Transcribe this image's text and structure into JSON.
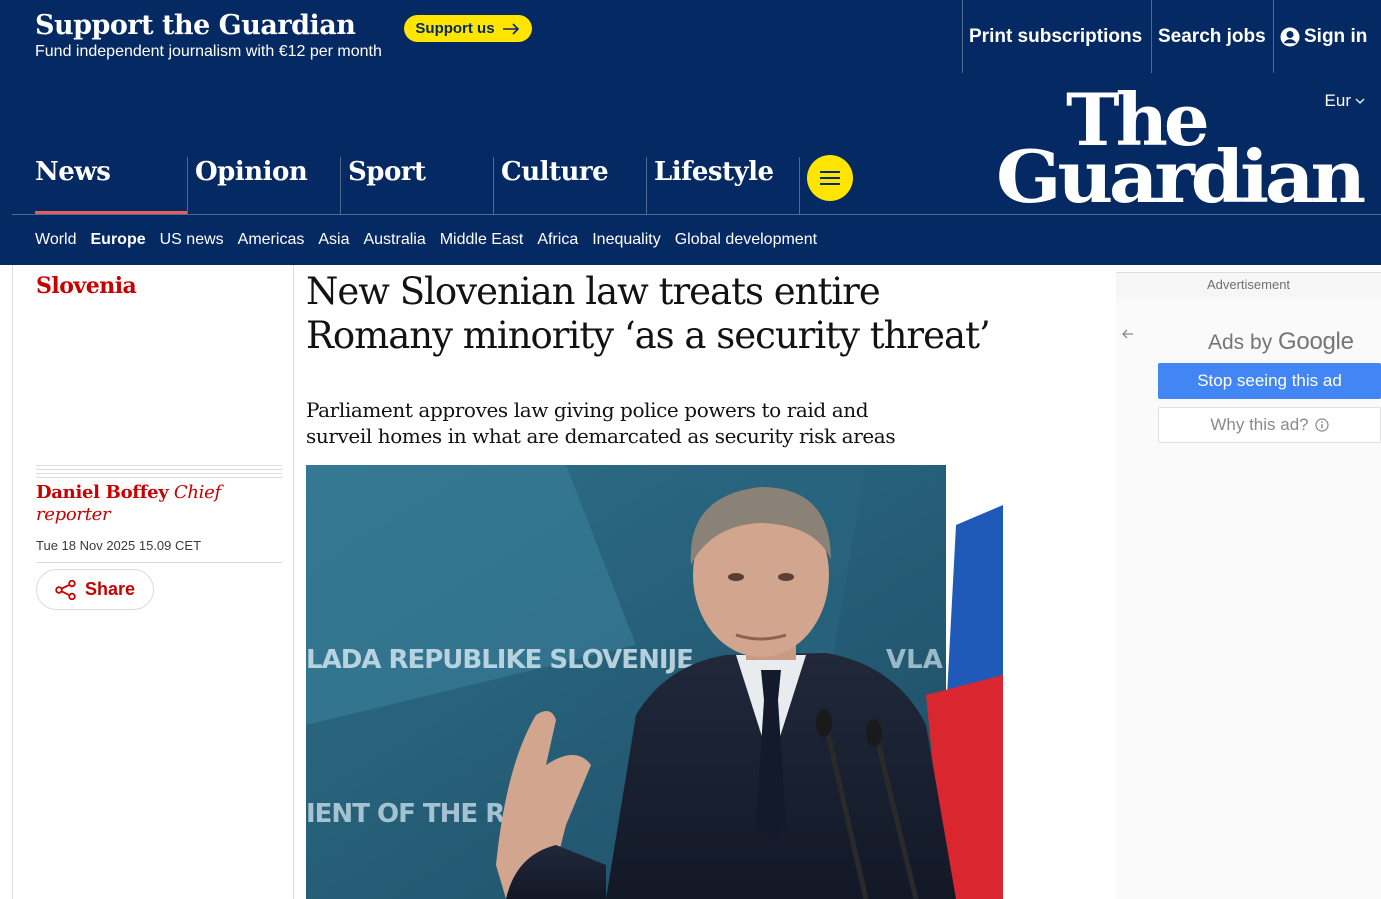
{
  "support_bar": {
    "title": "Support the Guardian",
    "subtitle": "Fund independent journalism with €12 per month",
    "button_label": "Support us",
    "links": {
      "print_subscriptions": "Print subscriptions",
      "search_jobs": "Search jobs",
      "sign_in": "Sign in"
    }
  },
  "masthead": {
    "edition": "Eur",
    "logo_line1": "The",
    "logo_line2": "Guardian",
    "pillars": [
      "News",
      "Opinion",
      "Sport",
      "Culture",
      "Lifestyle"
    ],
    "active_pillar": "News",
    "subnav": [
      "World",
      "Europe",
      "US news",
      "Americas",
      "Asia",
      "Australia",
      "Middle East",
      "Africa",
      "Inequality",
      "Global development"
    ],
    "active_subnav": "Europe"
  },
  "article": {
    "section": "Slovenia",
    "headline": "New Slovenian law treats entire Romany minority ‘as a security threat’",
    "standfirst": "Parliament approves law giving police powers to raid and surveil homes in what are demarcated as security risk areas",
    "author_name": "Daniel Boffey",
    "author_role": "Chief reporter",
    "dateline": "Tue 18 Nov 2025 15.09 CET",
    "share_label": "Share",
    "image_text_top": "LADA REPUBLIKE SLOVENIJE",
    "image_text_right": "VLA",
    "image_text_bottom": "IENT OF THE RE"
  },
  "ad": {
    "label": "Advertisement",
    "ads_by": "Ads by",
    "google": "Google",
    "stop_label": "Stop seeing this ad",
    "why_label": "Why this ad?"
  },
  "colors": {
    "brand_blue": "#052962",
    "support_yellow": "#ffe500",
    "news_red": "#c70000",
    "ad_blue": "#4285f4"
  }
}
